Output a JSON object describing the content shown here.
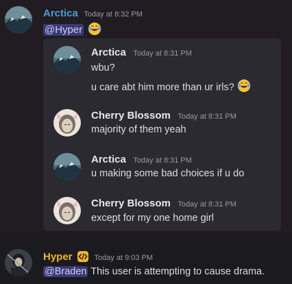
{
  "colors": {
    "arctica_name": "#4e9bd8",
    "cherry_name": "#e6e8ea",
    "hyper_name": "#f0b232",
    "mention_bg": "#3a3a73",
    "embed_bg": "#2b2a30"
  },
  "top_message": {
    "author": "Arctica",
    "timestamp": "Today at 8:32 PM",
    "mention": "@Hyper",
    "emoji": "joy-emoji"
  },
  "embed_messages": [
    {
      "author": "Arctica",
      "timestamp": "Today at 8:31 PM",
      "lines": [
        "wbu?",
        "u care abt him more than ur irls?"
      ]
    },
    {
      "author": "Cherry Blossom",
      "timestamp": "Today at 8:31 PM",
      "lines": [
        "majority of them yeah"
      ]
    },
    {
      "author": "Arctica",
      "timestamp": "Today at 8:31 PM",
      "lines": [
        "u making some bad choices if u do"
      ]
    },
    {
      "author": "Cherry Blossom",
      "timestamp": "Today at 8:31 PM",
      "lines": [
        "except for my one home girl"
      ]
    }
  ],
  "bottom_message": {
    "author": "Hyper",
    "badge_icon": "code-badge-icon",
    "timestamp": "Today at 9:03 PM",
    "mention": "@Braden",
    "text": "This user is attempting to cause drama."
  }
}
